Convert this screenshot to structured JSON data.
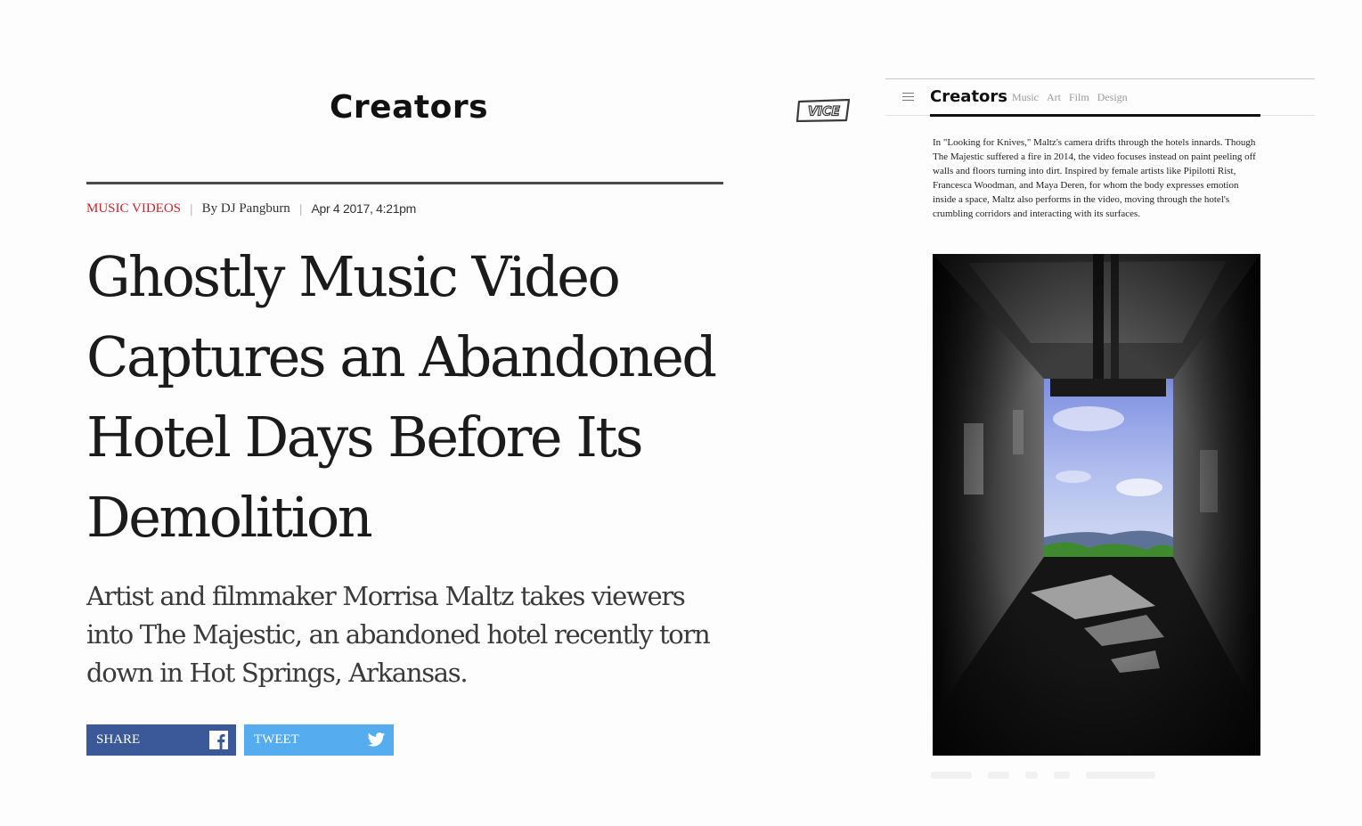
{
  "left_article": {
    "brand": "Creators",
    "category": "MUSIC VIDEOS",
    "byline": "By DJ Pangburn",
    "date": "Apr 4 2017, 4:21pm",
    "headline": "Ghostly Music Video Captures an Abandoned Hotel Days Before Its Demolition",
    "dek": "Artist and filmmaker Morrisa Maltz takes viewers into The Majestic, an abandoned hotel recently torn down in Hot Springs, Arkansas.",
    "share_label": "SHARE",
    "tweet_label": "TWEET"
  },
  "vice_logo": "VICE",
  "right_panel": {
    "brand": "Creators",
    "nav": [
      "Music",
      "Art",
      "Film",
      "Design"
    ],
    "body": "In \"Looking for Knives,\" Maltz's camera drifts through the hotels innards. Though The Majestic suffered a fire in 2014, the video focuses instead on paint peeling off walls and floors turning into dirt. Inspired by female artists like Pipilotti Rist, Francesca Woodman, and Maya Deren, for whom the body expresses emotion inside a space, Maltz also performs in the video, moving through the hotel's crumbling corridors and interacting with its surfaces."
  },
  "colors": {
    "category_red": "#c8252c",
    "facebook_blue": "#3b5998",
    "twitter_blue": "#55acee"
  },
  "icons": [
    "menu-icon",
    "facebook-icon",
    "twitter-icon"
  ]
}
